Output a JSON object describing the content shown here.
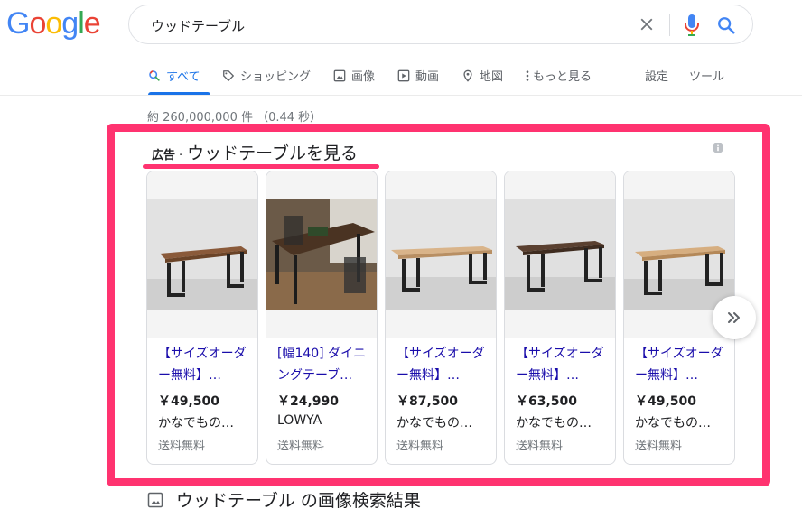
{
  "logo": {
    "letters": [
      "G",
      "o",
      "o",
      "g",
      "l",
      "e"
    ],
    "colors": [
      "#4285f4",
      "#ea4335",
      "#fbbc05",
      "#4285f4",
      "#34a853",
      "#ea4335"
    ]
  },
  "search": {
    "query": "ウッドテーブル"
  },
  "tabs": [
    {
      "label": "すべて",
      "icon": "search-icon",
      "active": true
    },
    {
      "label": "ショッピング",
      "icon": "tag-icon"
    },
    {
      "label": "画像",
      "icon": "image-icon"
    },
    {
      "label": "動画",
      "icon": "video-icon"
    },
    {
      "label": "地図",
      "icon": "map-pin-icon"
    },
    {
      "label": "もっと見る",
      "icon": "more-vert-icon"
    }
  ],
  "tools": {
    "settings": "設定",
    "tools": "ツール"
  },
  "stats": "約 260,000,000 件 （0.44 秒）",
  "ad": {
    "label": "広告",
    "dot": "·",
    "title": "ウッドテーブルを見る"
  },
  "products": [
    {
      "title": "【サイズオーダー無料】…",
      "price": "￥49,500",
      "seller": "かなでもの…",
      "shipping": "送料無料"
    },
    {
      "title": "[幅140] ダイニングテーブ…",
      "price": "￥24,990",
      "seller": "LOWYA",
      "shipping": "送料無料"
    },
    {
      "title": "【サイズオーダー無料】…",
      "price": "￥87,500",
      "seller": "かなでもの…",
      "shipping": "送料無料"
    },
    {
      "title": "【サイズオーダー無料】…",
      "price": "￥63,500",
      "seller": "かなでもの…",
      "shipping": "送料無料"
    },
    {
      "title": "【サイズオーダー無料】…",
      "price": "￥49,500",
      "seller": "かなでもの…",
      "shipping": "送料無料"
    }
  ],
  "image_results": {
    "heading": "ウッドテーブル の画像検索結果"
  },
  "colors": {
    "accent": "#1a73e8",
    "highlight": "#ff3370",
    "link": "#1a0dab"
  }
}
